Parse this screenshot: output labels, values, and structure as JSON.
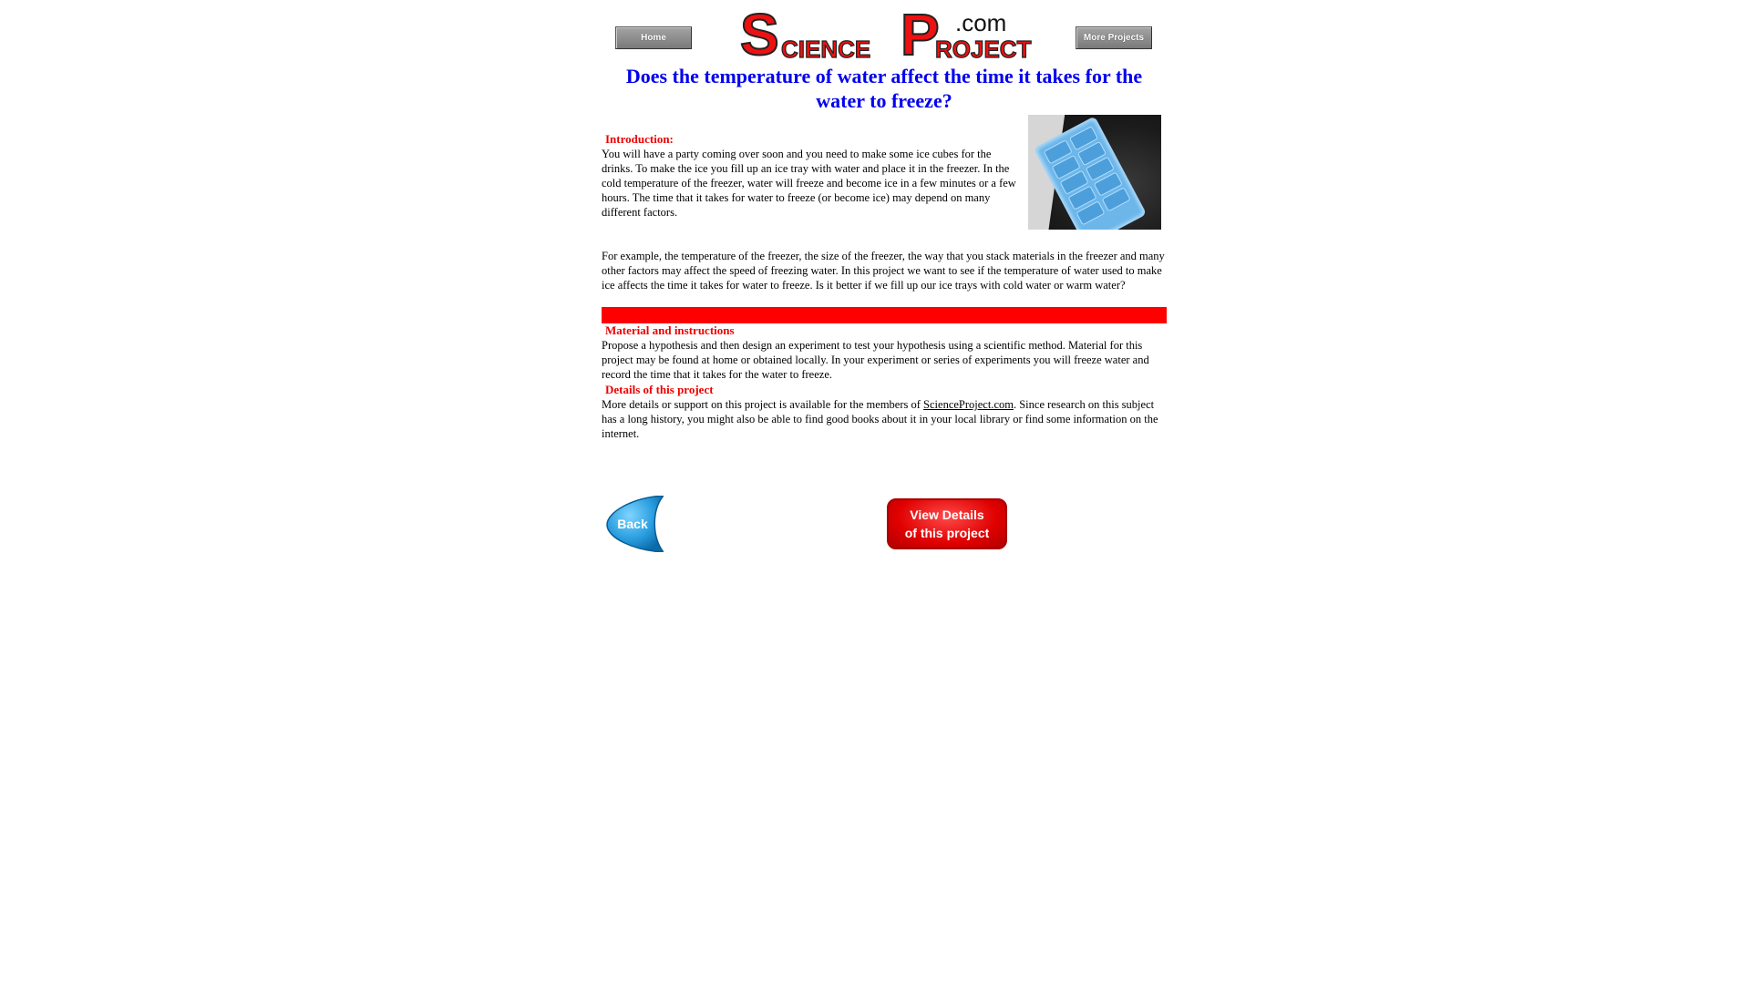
{
  "header": {
    "home_label": "Home",
    "more_label": "More Projects",
    "logo": {
      "s": "S",
      "cience": "CIENCE",
      "p": "P",
      "roject": "ROJECT",
      "dotcom": ".com"
    }
  },
  "title": "Does the temperature of water affect the time it takes for the water to freeze?",
  "intro": {
    "heading": "Introduction:",
    "text": "You will have a party coming over soon and you need to make some ice cubes for the drinks. To make the ice you fill up an ice tray with water and place it in the freezer. In the cold temperature of the freezer, water will freeze and become ice in a few minutes or a few hours. The time that it takes for water to freeze (or become ice) may depend on many different factors.",
    "text2": "For example, the temperature of the freezer, the size of the freezer, the way that you stack materials in the freezer and many other factors may affect the speed of freezing water.  In this project we want to see if the temperature of water used to make ice affects the time it takes for water to freeze. Is it better if we fill up our ice trays with cold water or warm water?"
  },
  "materials": {
    "heading": "Material and instructions",
    "text": "Propose a hypothesis and then design an experiment to test your hypothesis using a scientific method. Material for this project may be found at home or obtained locally. In your experiment or series of experiments you will freeze water and record the time that it takes for the water to freeze."
  },
  "details": {
    "heading": "Details of this project",
    "text_before": "More details or support on this project is available for the members of ",
    "link": "ScienceProject.com",
    "text_after": ". Since research on this subject has a long history, you might also be able to find good books about it in your local library or find some information on the internet."
  },
  "buttons": {
    "back": "Back",
    "view_line1": "View Details",
    "view_line2": "of this project"
  },
  "colors": {
    "title": "#0000ee",
    "heading": "#ee0000",
    "bar": "#ff0000"
  },
  "icons": {
    "image": "ice-tray-photo"
  }
}
